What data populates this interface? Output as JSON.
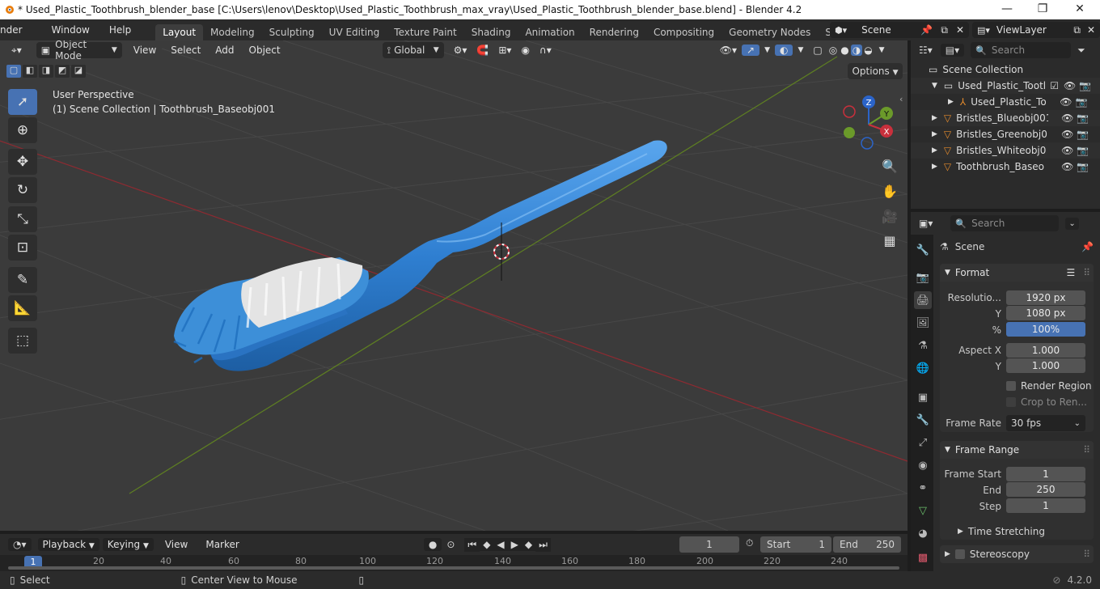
{
  "window": {
    "title": "* Used_Plastic_Toothbrush_blender_base [C:\\Users\\lenov\\Desktop\\Used_Plastic_Toothbrush_max_vray\\Used_Plastic_Toothbrush_blender_base.blend] - Blender 4.2",
    "minimize": "—",
    "maximize": "❐",
    "close": "✕"
  },
  "menu": {
    "items": [
      "nder",
      "Window",
      "Help"
    ],
    "workspaces": [
      "Layout",
      "Modeling",
      "Sculpting",
      "UV Editing",
      "Texture Paint",
      "Shading",
      "Animation",
      "Rendering",
      "Compositing",
      "Geometry Nodes",
      "Scripting"
    ],
    "active_workspace": "Layout",
    "add_workspace": "+",
    "scene_name": "Scene",
    "view_layer": "ViewLayer"
  },
  "viewport": {
    "mode": "Object Mode",
    "menus": [
      "View",
      "Select",
      "Add",
      "Object"
    ],
    "orientation": "Global",
    "options_label": "Options",
    "perspective_label": "User Perspective",
    "collection_label": "(1) Scene Collection | Toothbrush_Baseobj001",
    "gizmo": {
      "x": "X",
      "y": "Y",
      "z": "Z"
    }
  },
  "outliner": {
    "search_placeholder": "Search",
    "root": "Scene Collection",
    "items": [
      {
        "name": "Used_Plastic_Tootl",
        "type": "collection"
      },
      {
        "name": "Used_Plastic_To",
        "type": "empty"
      },
      {
        "name": "Bristles_Blueobj001",
        "type": "mesh"
      },
      {
        "name": "Bristles_Greenobj0",
        "type": "mesh"
      },
      {
        "name": "Bristles_Whiteobj0",
        "type": "mesh"
      },
      {
        "name": "Toothbrush_Baseo",
        "type": "mesh"
      }
    ]
  },
  "properties": {
    "search_placeholder": "Search",
    "context": "Scene",
    "format_panel": "Format",
    "resolution_label": "Resolutio...",
    "resolution_x": "1920 px",
    "y_label": "Y",
    "resolution_y": "1080 px",
    "percent_label": "%",
    "resolution_percent": "100%",
    "aspect_x_label": "Aspect X",
    "aspect_x": "1.000",
    "aspect_y": "1.000",
    "render_region": "Render Region",
    "crop": "Crop to Ren...",
    "frame_rate_label": "Frame Rate",
    "frame_rate": "30 fps",
    "frame_range_panel": "Frame Range",
    "frame_start_label": "Frame Start",
    "frame_start": "1",
    "end_label": "End",
    "frame_end": "250",
    "step_label": "Step",
    "frame_step": "1",
    "time_stretching": "Time Stretching",
    "stereoscopy": "Stereoscopy"
  },
  "timeline": {
    "menus": [
      "Playback",
      "Keying",
      "View",
      "Marker"
    ],
    "current_frame": "1",
    "start_label": "Start",
    "start": "1",
    "end_label": "End",
    "end": "250",
    "ticks": [
      "1",
      "20",
      "40",
      "60",
      "80",
      "100",
      "120",
      "140",
      "160",
      "180",
      "200",
      "220",
      "240"
    ]
  },
  "status": {
    "select": "Select",
    "center_view": "Center View to Mouse",
    "version": "4.2.0"
  },
  "colors": {
    "accent": "#4772b3",
    "toothbrush": "#2f7fd1",
    "x_axis": "#c9303c",
    "y_axis": "#6b9a2a"
  }
}
